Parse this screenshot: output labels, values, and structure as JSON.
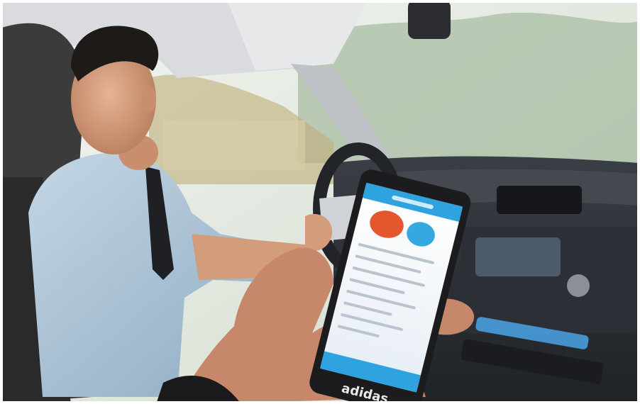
{
  "photo": {
    "subject": "driver-and-phone",
    "colors": {
      "window_light": "#e8ece6",
      "trees": "#9fb59a",
      "dashboard": "#2a2d33",
      "shirt": "#a9c2d6",
      "skin": "#d9a07e",
      "hair": "#1e1a18",
      "phone_body": "#1c1c1e",
      "phone_screen": "#f3f6fb",
      "app_accent": "#2fa3df",
      "bubble_orange": "#e4572e",
      "bubble_blue": "#35a8e0",
      "ambient_blue": "#4aa3e8"
    }
  },
  "phone": {
    "brand_text": "adidas"
  }
}
